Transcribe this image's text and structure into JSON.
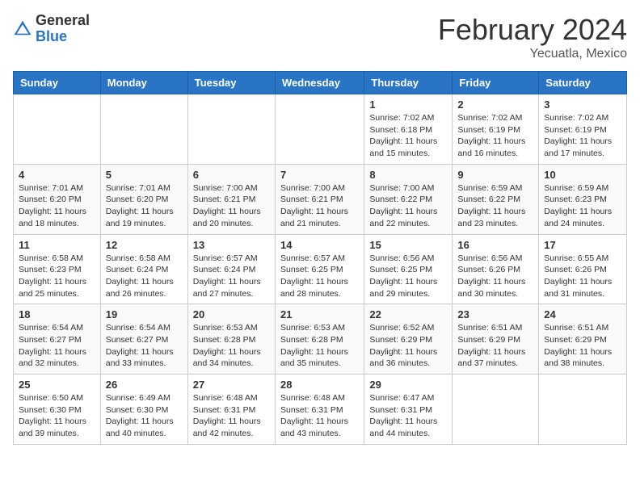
{
  "logo": {
    "general": "General",
    "blue": "Blue"
  },
  "title": "February 2024",
  "subtitle": "Yecuatla, Mexico",
  "days_of_week": [
    "Sunday",
    "Monday",
    "Tuesday",
    "Wednesday",
    "Thursday",
    "Friday",
    "Saturday"
  ],
  "weeks": [
    [
      {
        "day": "",
        "info": ""
      },
      {
        "day": "",
        "info": ""
      },
      {
        "day": "",
        "info": ""
      },
      {
        "day": "",
        "info": ""
      },
      {
        "day": "1",
        "info": "Sunrise: 7:02 AM\nSunset: 6:18 PM\nDaylight: 11 hours and 15 minutes."
      },
      {
        "day": "2",
        "info": "Sunrise: 7:02 AM\nSunset: 6:19 PM\nDaylight: 11 hours and 16 minutes."
      },
      {
        "day": "3",
        "info": "Sunrise: 7:02 AM\nSunset: 6:19 PM\nDaylight: 11 hours and 17 minutes."
      }
    ],
    [
      {
        "day": "4",
        "info": "Sunrise: 7:01 AM\nSunset: 6:20 PM\nDaylight: 11 hours and 18 minutes."
      },
      {
        "day": "5",
        "info": "Sunrise: 7:01 AM\nSunset: 6:20 PM\nDaylight: 11 hours and 19 minutes."
      },
      {
        "day": "6",
        "info": "Sunrise: 7:00 AM\nSunset: 6:21 PM\nDaylight: 11 hours and 20 minutes."
      },
      {
        "day": "7",
        "info": "Sunrise: 7:00 AM\nSunset: 6:21 PM\nDaylight: 11 hours and 21 minutes."
      },
      {
        "day": "8",
        "info": "Sunrise: 7:00 AM\nSunset: 6:22 PM\nDaylight: 11 hours and 22 minutes."
      },
      {
        "day": "9",
        "info": "Sunrise: 6:59 AM\nSunset: 6:22 PM\nDaylight: 11 hours and 23 minutes."
      },
      {
        "day": "10",
        "info": "Sunrise: 6:59 AM\nSunset: 6:23 PM\nDaylight: 11 hours and 24 minutes."
      }
    ],
    [
      {
        "day": "11",
        "info": "Sunrise: 6:58 AM\nSunset: 6:23 PM\nDaylight: 11 hours and 25 minutes."
      },
      {
        "day": "12",
        "info": "Sunrise: 6:58 AM\nSunset: 6:24 PM\nDaylight: 11 hours and 26 minutes."
      },
      {
        "day": "13",
        "info": "Sunrise: 6:57 AM\nSunset: 6:24 PM\nDaylight: 11 hours and 27 minutes."
      },
      {
        "day": "14",
        "info": "Sunrise: 6:57 AM\nSunset: 6:25 PM\nDaylight: 11 hours and 28 minutes."
      },
      {
        "day": "15",
        "info": "Sunrise: 6:56 AM\nSunset: 6:25 PM\nDaylight: 11 hours and 29 minutes."
      },
      {
        "day": "16",
        "info": "Sunrise: 6:56 AM\nSunset: 6:26 PM\nDaylight: 11 hours and 30 minutes."
      },
      {
        "day": "17",
        "info": "Sunrise: 6:55 AM\nSunset: 6:26 PM\nDaylight: 11 hours and 31 minutes."
      }
    ],
    [
      {
        "day": "18",
        "info": "Sunrise: 6:54 AM\nSunset: 6:27 PM\nDaylight: 11 hours and 32 minutes."
      },
      {
        "day": "19",
        "info": "Sunrise: 6:54 AM\nSunset: 6:27 PM\nDaylight: 11 hours and 33 minutes."
      },
      {
        "day": "20",
        "info": "Sunrise: 6:53 AM\nSunset: 6:28 PM\nDaylight: 11 hours and 34 minutes."
      },
      {
        "day": "21",
        "info": "Sunrise: 6:53 AM\nSunset: 6:28 PM\nDaylight: 11 hours and 35 minutes."
      },
      {
        "day": "22",
        "info": "Sunrise: 6:52 AM\nSunset: 6:29 PM\nDaylight: 11 hours and 36 minutes."
      },
      {
        "day": "23",
        "info": "Sunrise: 6:51 AM\nSunset: 6:29 PM\nDaylight: 11 hours and 37 minutes."
      },
      {
        "day": "24",
        "info": "Sunrise: 6:51 AM\nSunset: 6:29 PM\nDaylight: 11 hours and 38 minutes."
      }
    ],
    [
      {
        "day": "25",
        "info": "Sunrise: 6:50 AM\nSunset: 6:30 PM\nDaylight: 11 hours and 39 minutes."
      },
      {
        "day": "26",
        "info": "Sunrise: 6:49 AM\nSunset: 6:30 PM\nDaylight: 11 hours and 40 minutes."
      },
      {
        "day": "27",
        "info": "Sunrise: 6:48 AM\nSunset: 6:31 PM\nDaylight: 11 hours and 42 minutes."
      },
      {
        "day": "28",
        "info": "Sunrise: 6:48 AM\nSunset: 6:31 PM\nDaylight: 11 hours and 43 minutes."
      },
      {
        "day": "29",
        "info": "Sunrise: 6:47 AM\nSunset: 6:31 PM\nDaylight: 11 hours and 44 minutes."
      },
      {
        "day": "",
        "info": ""
      },
      {
        "day": "",
        "info": ""
      }
    ]
  ]
}
